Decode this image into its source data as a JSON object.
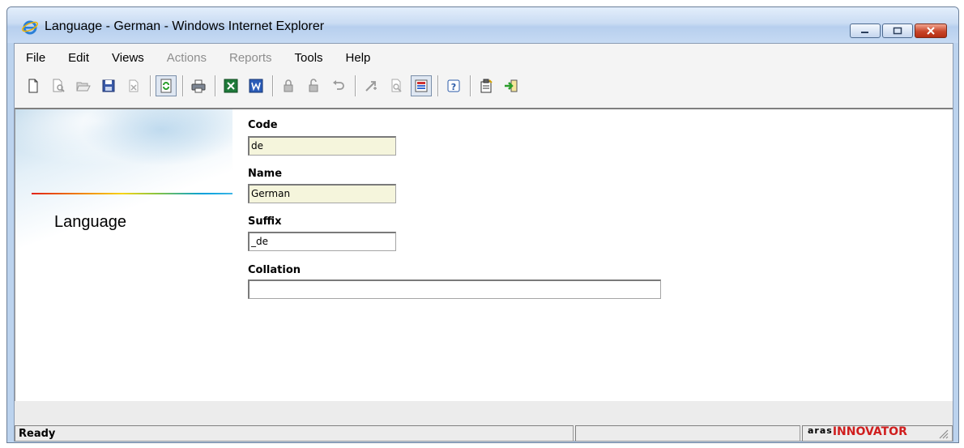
{
  "window": {
    "title": "Language - German - Windows Internet Explorer",
    "icon": "ie-icon"
  },
  "menu": [
    {
      "label": "File",
      "enabled": true
    },
    {
      "label": "Edit",
      "enabled": true
    },
    {
      "label": "Views",
      "enabled": true
    },
    {
      "label": "Actions",
      "enabled": false
    },
    {
      "label": "Reports",
      "enabled": false
    },
    {
      "label": "Tools",
      "enabled": true
    },
    {
      "label": "Help",
      "enabled": true
    }
  ],
  "toolbar_icons": [
    "new-document-icon",
    "print-preview-icon",
    "open-folder-icon",
    "save-icon",
    "delete-icon",
    "refresh-icon",
    "print-icon",
    "excel-export-icon",
    "word-export-icon",
    "lock-icon",
    "unlock-icon",
    "undo-icon",
    "promote-icon",
    "where-used-icon",
    "structure-browser-icon",
    "help-icon",
    "properties-icon",
    "exit-icon"
  ],
  "banner": {
    "title": "Language"
  },
  "form": {
    "code": {
      "label": "Code",
      "value": "de"
    },
    "name": {
      "label": "Name",
      "value": "German"
    },
    "suffix": {
      "label": "Suffix",
      "value": "_de"
    },
    "collation": {
      "label": "Collation",
      "value": ""
    }
  },
  "status": {
    "text": "Ready",
    "logo_top": "aras",
    "logo_bottom": "INNOVATOR"
  },
  "colors": {
    "required_field_bg": "#f5f5dc",
    "logo_red": "#d01e1e"
  }
}
